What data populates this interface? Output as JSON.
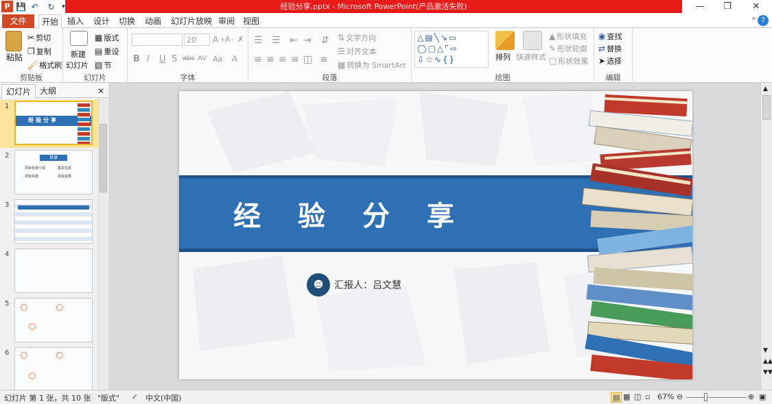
{
  "window": {
    "title": "经验分享.pptx - Microsoft PowerPoint(产品激活失败)",
    "minimize": "—",
    "restore": "❐",
    "close": "✕"
  },
  "qat": {
    "app_icon": "P",
    "save_icon": "save-icon",
    "undo_icon": "undo-icon",
    "redo_icon": "redo-icon"
  },
  "tabs": {
    "file": "文件",
    "items": [
      "开始",
      "插入",
      "设计",
      "切换",
      "动画",
      "幻灯片放映",
      "审阅",
      "视图"
    ]
  },
  "ribbon": {
    "clipboard": {
      "paste": "粘贴",
      "cut": "剪切",
      "copy": "复制",
      "format_painter": "格式刷",
      "label": "剪贴板"
    },
    "slides": {
      "new_slide": "新建",
      "new_slide2": "幻灯片",
      "layout": "版式",
      "reset": "重设",
      "section": "节",
      "label": "幻灯片"
    },
    "font": {
      "size": "20",
      "bold": "B",
      "italic": "I",
      "underline": "U",
      "shadow": "S",
      "strike": "abc",
      "spacing": "AV",
      "case": "Aa",
      "color": "A",
      "label": "字体"
    },
    "paragraph": {
      "text_direction": "文字方向",
      "align_text": "对齐文本",
      "smartart": "转换为 SmartArt",
      "label": "段落"
    },
    "drawing": {
      "arrange": "排列",
      "quick_styles": "快速样式",
      "shape_fill": "形状填充",
      "shape_outline": "形状轮廓",
      "shape_effects": "形状效果",
      "label": "绘图"
    },
    "editing": {
      "find": "查找",
      "replace": "替换",
      "select": "选择",
      "label": "编辑"
    }
  },
  "panel": {
    "tab_slides": "幻灯片",
    "tab_outline": "大纲",
    "close": "✕",
    "slide_numbers": [
      "1",
      "2",
      "3",
      "4",
      "5",
      "6"
    ],
    "thumb1_title": "经验分享",
    "thumb2_title": "目录",
    "thumb2_items": [
      "项目背景介绍",
      "基本信息",
      "项目实施",
      "项目成果"
    ]
  },
  "slide": {
    "title": "经 验 分 享",
    "presenter": "汇报人：吕文慧",
    "colors": {
      "band": "#2f6fb3",
      "band_dark": "#1e4f86",
      "avatar": "#1f4e79"
    }
  },
  "status": {
    "slide_info": "幻灯片 第 1 张，共 10 张",
    "theme": "\"版式\"",
    "language": "中文(中国)",
    "zoom": "67%"
  }
}
